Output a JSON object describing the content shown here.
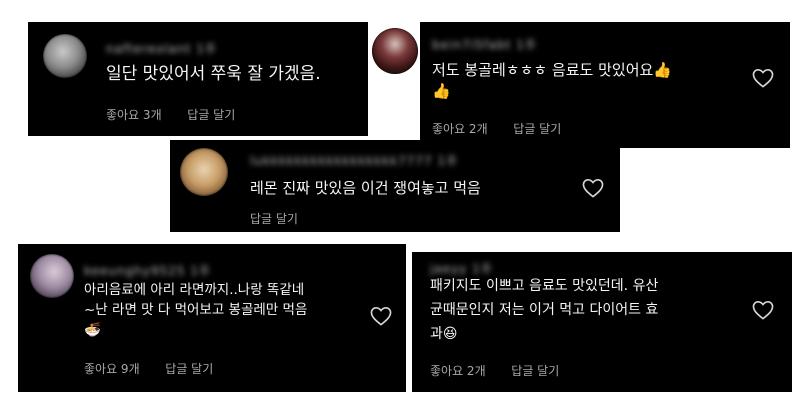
{
  "comments": [
    {
      "username": "naftereolant",
      "time": "1주",
      "lines": [
        "일단 맛있어서 쭈욱 잘 가겠음."
      ],
      "likes": "좋아요 3개",
      "reply": "답글 달기",
      "avatar_icon": "avatar-icon"
    },
    {
      "username": "bein7i5fabt",
      "time": "1주",
      "lines": [
        "저도 봉골레ㅎㅎㅎ 음료도 맛있어요👍",
        "👍"
      ],
      "likes": "좋아요 2개",
      "reply": "답글 달기",
      "avatar_icon": "avatar-icon"
    },
    {
      "username": "lukkkkkkkkkkkkkkkkk7777",
      "time": "1주",
      "lines": [
        "레몬 진짜 맛있음 이건 쟁여놓고 먹음"
      ],
      "likes": "",
      "reply": "답글 달기",
      "avatar_icon": "avatar-icon"
    },
    {
      "username": "keeunghy9525",
      "time": "1주",
      "lines": [
        "아리음료에 아리 라면까지..나랑 똑같네",
        "~난 라면 맛 다 먹어보고 봉골레만 먹음",
        "🍜"
      ],
      "likes": "좋아요 9개",
      "reply": "답글 달기",
      "avatar_icon": "avatar-icon"
    },
    {
      "username": "jaeyy",
      "time": "1주",
      "lines": [
        "패키지도 이쁘고 음료도 맛있던데. 유산",
        "균때문인지 저는 이거 먹고 다이어트 효",
        "과😆"
      ],
      "likes": "좋아요 2개",
      "reply": "답글 달기",
      "avatar_icon": "avatar-icon"
    }
  ],
  "colors": {
    "card_bg": "#000000",
    "page_bg": "#ffffff",
    "text": "#f5f5f5",
    "meta": "#a8a8a8",
    "heart": "#d6d6d6"
  }
}
